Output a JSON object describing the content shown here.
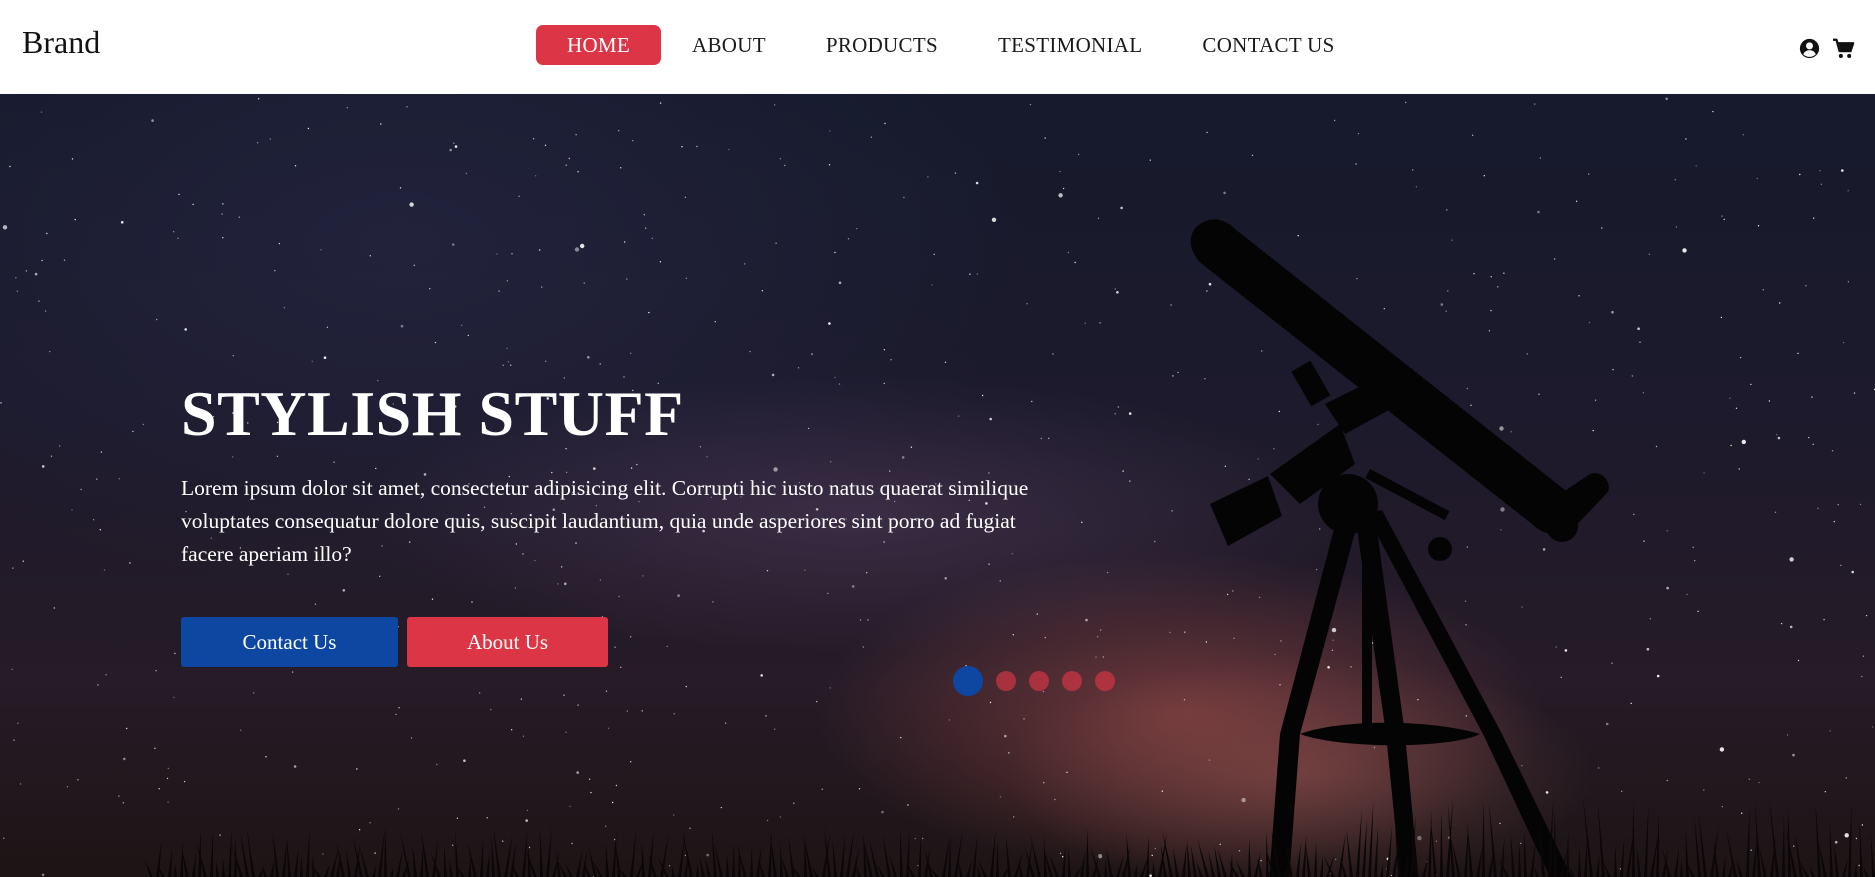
{
  "navbar": {
    "brand": "Brand",
    "links": [
      {
        "label": "HOME",
        "active": true
      },
      {
        "label": "ABOUT",
        "active": false
      },
      {
        "label": "PRODUCTS",
        "active": false
      },
      {
        "label": "TESTIMONIAL",
        "active": false
      },
      {
        "label": "CONTACT US",
        "active": false
      }
    ],
    "icons": [
      "user-circle-icon",
      "shopping-cart-icon"
    ]
  },
  "hero": {
    "title": "STYLISH STUFF",
    "text": "Lorem ipsum dolor sit amet, consectetur adipisicing elit. Corrupti hic iusto natus quaerat similique voluptates consequatur dolore quis, suscipit laudantium, quia unde asperiores sint porro ad fugiat facere aperiam illo?",
    "buttons": {
      "contact": "Contact Us",
      "about": "About Us"
    },
    "carousel": {
      "slide_count": 5,
      "active_index": 0
    },
    "background": "night-sky-telescope-image"
  },
  "colors": {
    "accent_red": "#dc3545",
    "accent_blue": "#0d47a1",
    "navbar_bg": "#ffffff",
    "text_light": "#ffffff"
  }
}
